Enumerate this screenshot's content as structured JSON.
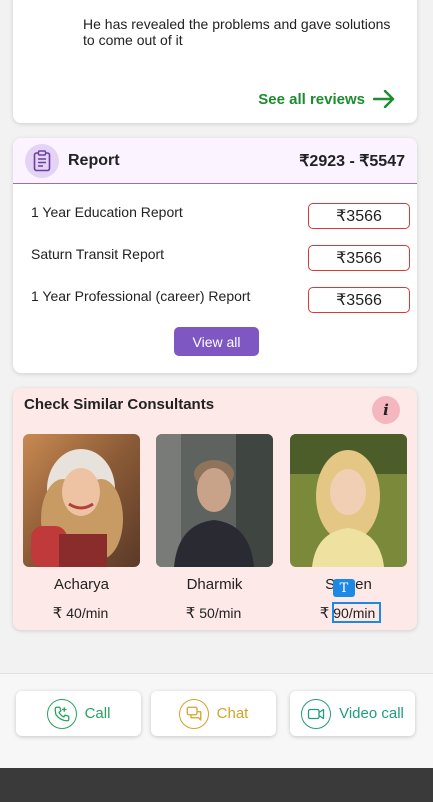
{
  "review": {
    "text": "He has revealed the problems and gave solutions to come out of it",
    "see_all_label": "See all reviews"
  },
  "report": {
    "title": "Report",
    "price_range": "₹2923 - ₹5547",
    "items": [
      {
        "name": "1 Year Education Report",
        "price": "₹3566"
      },
      {
        "name": "Saturn Transit Report",
        "price": "₹3566"
      },
      {
        "name": "1 Year Professional (career) Report",
        "price": "₹3566"
      }
    ],
    "view_all_label": "View all"
  },
  "consultants": {
    "title": "Check Similar Consultants",
    "info_label": "i",
    "items": [
      {
        "name": "Acharya",
        "currency": "₹",
        "rate": "40/min"
      },
      {
        "name": "Dharmik",
        "currency": "₹",
        "rate": "50/min"
      },
      {
        "name": "Su  sen",
        "currency": "₹",
        "rate": "90/min"
      }
    ]
  },
  "overlay": {
    "tag_label": "T"
  },
  "actions": {
    "call_label": "Call",
    "chat_label": "Chat",
    "video_label": "Video call"
  },
  "colors": {
    "accent_green": "#1e8c2e",
    "report_purple": "#7e57c2",
    "price_border_red": "#d83a3a",
    "call_green": "#27a35e",
    "chat_gold": "#d4a22a",
    "video_teal": "#1f9e7a",
    "selection_blue": "#1e88e5"
  }
}
